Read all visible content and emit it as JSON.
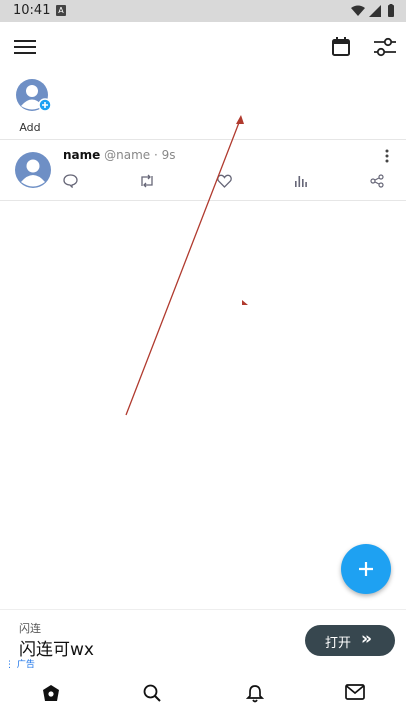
{
  "status_bar": {
    "time": "10:41",
    "sim_badge": "A"
  },
  "top_bar": {
    "menu_icon": "hamburger-icon",
    "calendar_icon": "calendar-icon",
    "filter_icon": "sliders-icon"
  },
  "stories": {
    "add_label": "Add"
  },
  "post": {
    "name": "name",
    "handle": "@name · 9s",
    "actions": [
      "comment-icon",
      "retweet-icon",
      "like-icon",
      "stats-icon",
      "share-icon"
    ]
  },
  "fab": {
    "icon": "plus-icon"
  },
  "ad": {
    "brand": "闪连",
    "title": "闪连可wx",
    "tag": "广告",
    "button_label": "打开",
    "button_chevron": "»"
  },
  "bottom_nav": [
    "home-icon",
    "search-icon",
    "bell-icon",
    "mail-icon"
  ],
  "colors": {
    "accent": "#1ea1f2",
    "ad_button": "#37474f",
    "annotation_arrow": "#b03a2e"
  }
}
